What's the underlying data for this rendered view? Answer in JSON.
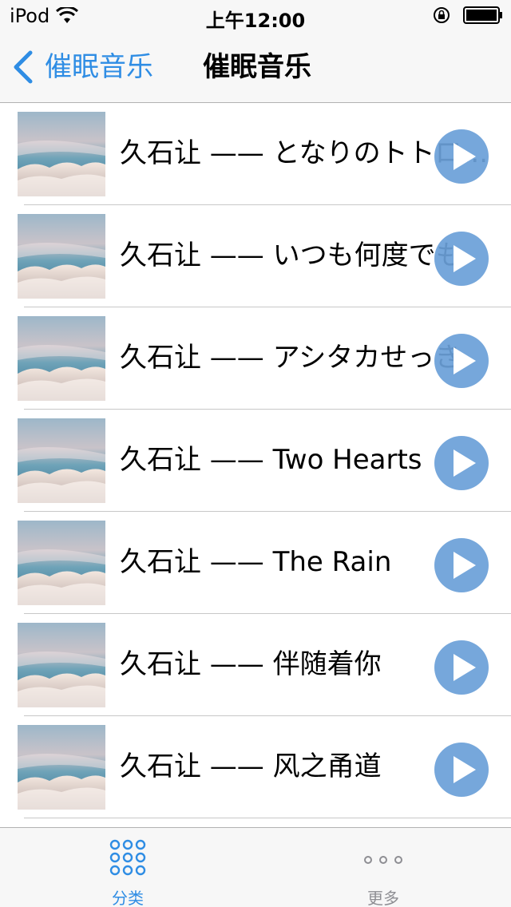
{
  "status_bar": {
    "carrier": "iPod",
    "time": "上午12:00"
  },
  "nav": {
    "back_label": "催眠音乐",
    "title": "催眠音乐"
  },
  "songs": [
    {
      "title": "久石让 —— となりのトトロ..."
    },
    {
      "title": "久石让 —— いつも何度でも"
    },
    {
      "title": "久石让 —— アシタカせっき"
    },
    {
      "title": "久石让 —— Two Hearts"
    },
    {
      "title": "久石让 —— The Rain"
    },
    {
      "title": "久石让 —— 伴随着你"
    },
    {
      "title": "久石让 —— 风之甬道"
    },
    {
      "title": ""
    }
  ],
  "tabs": [
    {
      "label": "分类",
      "icon": "grid-dots-icon",
      "selected": true
    },
    {
      "label": "更多",
      "icon": "more-dots-icon",
      "selected": false
    }
  ],
  "colors": {
    "accent": "#2f8de4",
    "play_button": "#6a9fd8",
    "inactive_tab": "#8e8e93"
  }
}
